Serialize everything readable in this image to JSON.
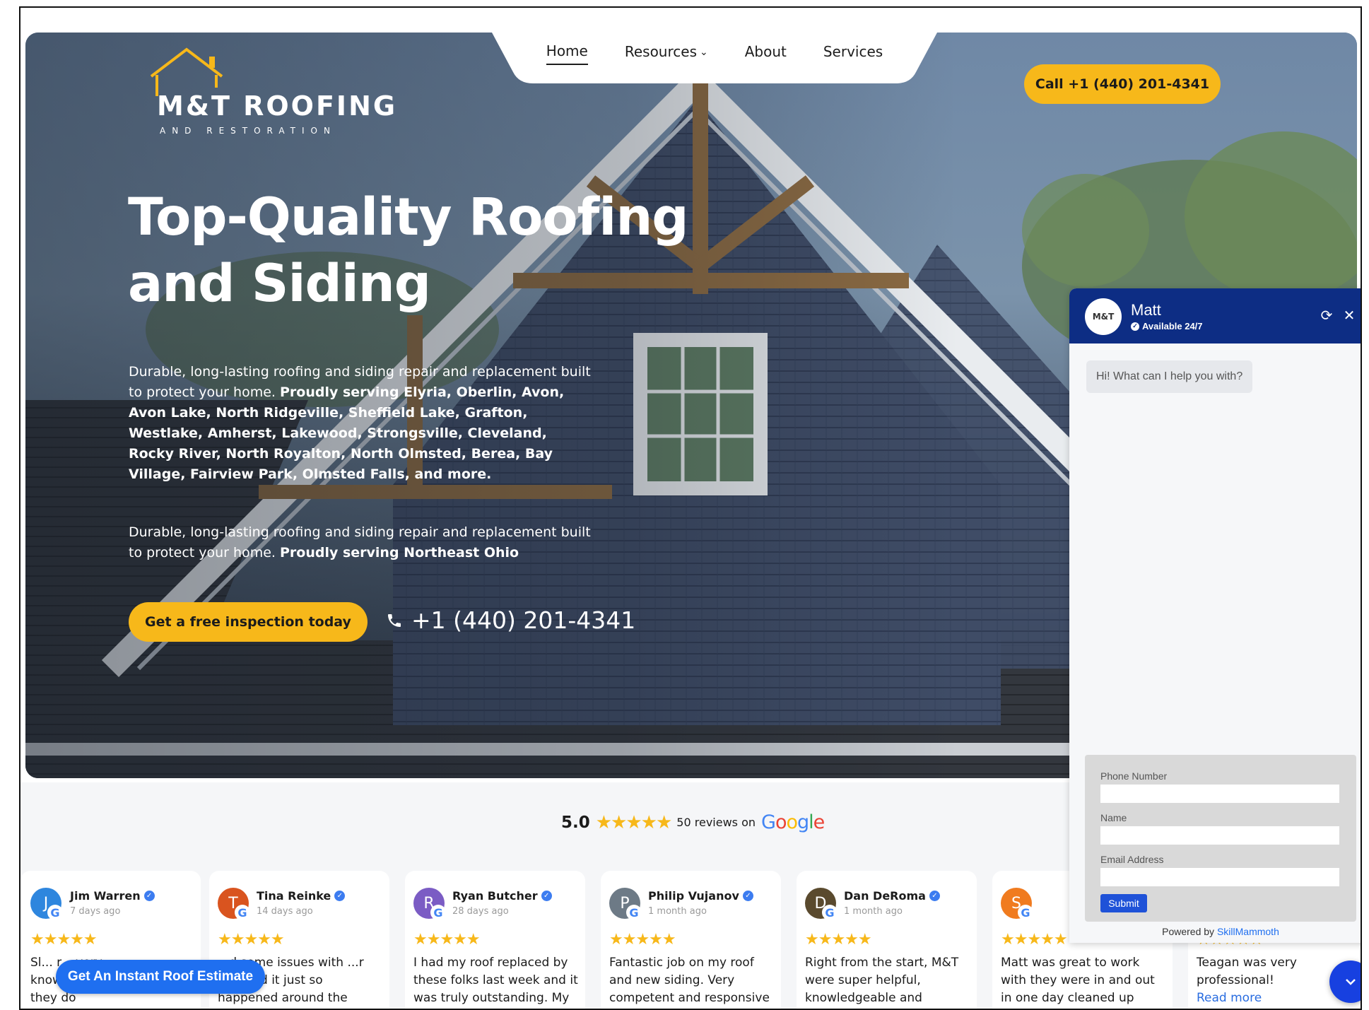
{
  "brand": {
    "name": "M&T ROOFING",
    "sub": "AND RESTORATION"
  },
  "nav": {
    "items": [
      "Home",
      "Resources",
      "About",
      "Services"
    ],
    "active": "Home"
  },
  "header": {
    "call_label": "Call +1 (440) 201-4341"
  },
  "hero": {
    "headline_line1": "Top-Quality Roofing",
    "headline_line2": "and Siding",
    "para1_normal": "Durable, long-lasting roofing and siding repair and replacement built to protect your home. ",
    "para1_bold": "Proudly serving Elyria, Oberlin, Avon, Avon Lake, North Ridgeville, Sheffield Lake, Grafton, Westlake, Amherst, Lakewood, Strongsville, Cleveland, Rocky River, North Royalton, North Olmsted, Berea, Bay Village, Fairview Park, Olmsted Falls, and more.",
    "para2_normal": "Durable, long-lasting roofing and siding repair and replacement built to protect your home. ",
    "para2_bold": "Proudly serving Northeast Ohio",
    "cta_label": "Get a free inspection today",
    "phone": "+1 (440) 201-4341"
  },
  "rating": {
    "score": "5.0",
    "stars": "★★★★★",
    "count_text": "50 reviews on",
    "google": [
      "G",
      "o",
      "o",
      "g",
      "l",
      "e"
    ]
  },
  "reviews": [
    {
      "initial": "J",
      "name": "Jim Warren",
      "time": "7 days ago",
      "stars": "★★★★★",
      "text": "Sl... r... very knowledgeable. Of what they do",
      "color": "#2e86de"
    },
    {
      "initial": "T",
      "name": "Tina Reinke",
      "time": "14 days ago",
      "stars": "★★★★★",
      "text": "...d some issues with ...r roof and it just so happened around the same time M&T was",
      "color": "#d9541f"
    },
    {
      "initial": "R",
      "name": "Ryan Butcher",
      "time": "28 days ago",
      "stars": "★★★★★",
      "text": "I had my roof replaced by these folks last week and it was truly outstanding. My roof",
      "color": "#7b5cc4"
    },
    {
      "initial": "P",
      "name": "Philip Vujanov",
      "time": "1 month ago",
      "stars": "★★★★★",
      "text": "Fantastic job on my roof and new siding. Very competent and responsive and I highly",
      "color": "#6d7a86"
    },
    {
      "initial": "D",
      "name": "Dan DeRoma",
      "time": "1 month ago",
      "stars": "★★★★★",
      "text": "Right from the start, M&T were super helpful, knowledgeable and",
      "color": "#5a4a2e"
    },
    {
      "initial": "S",
      "name": "",
      "time": "",
      "stars": "★★★★★",
      "text": "Matt was great to work with they were in and out in one day cleaned up everything nicely",
      "color": "#f07b1f"
    },
    {
      "initial": "",
      "name": "",
      "time": "",
      "stars": "★★★★★",
      "text": "Teagan was very professional!",
      "read_more": "Read more",
      "color": "#ffffff"
    }
  ],
  "estimate_label": "Get An Instant Roof Estimate",
  "chat": {
    "avatar_text": "M&T",
    "name": "Matt",
    "status": "Available 24/7",
    "greeting": "Hi! What can I help you with?",
    "phone_label": "Phone Number",
    "name_label": "Name",
    "email_label": "Email Address",
    "submit_label": "Submit",
    "powered_prefix": "Powered by",
    "powered_link": "SkillMammoth"
  },
  "colors": {
    "accent_yellow": "#f7b81a",
    "chat_header": "#0d2d84",
    "estimate_blue": "#1f6ff0"
  }
}
